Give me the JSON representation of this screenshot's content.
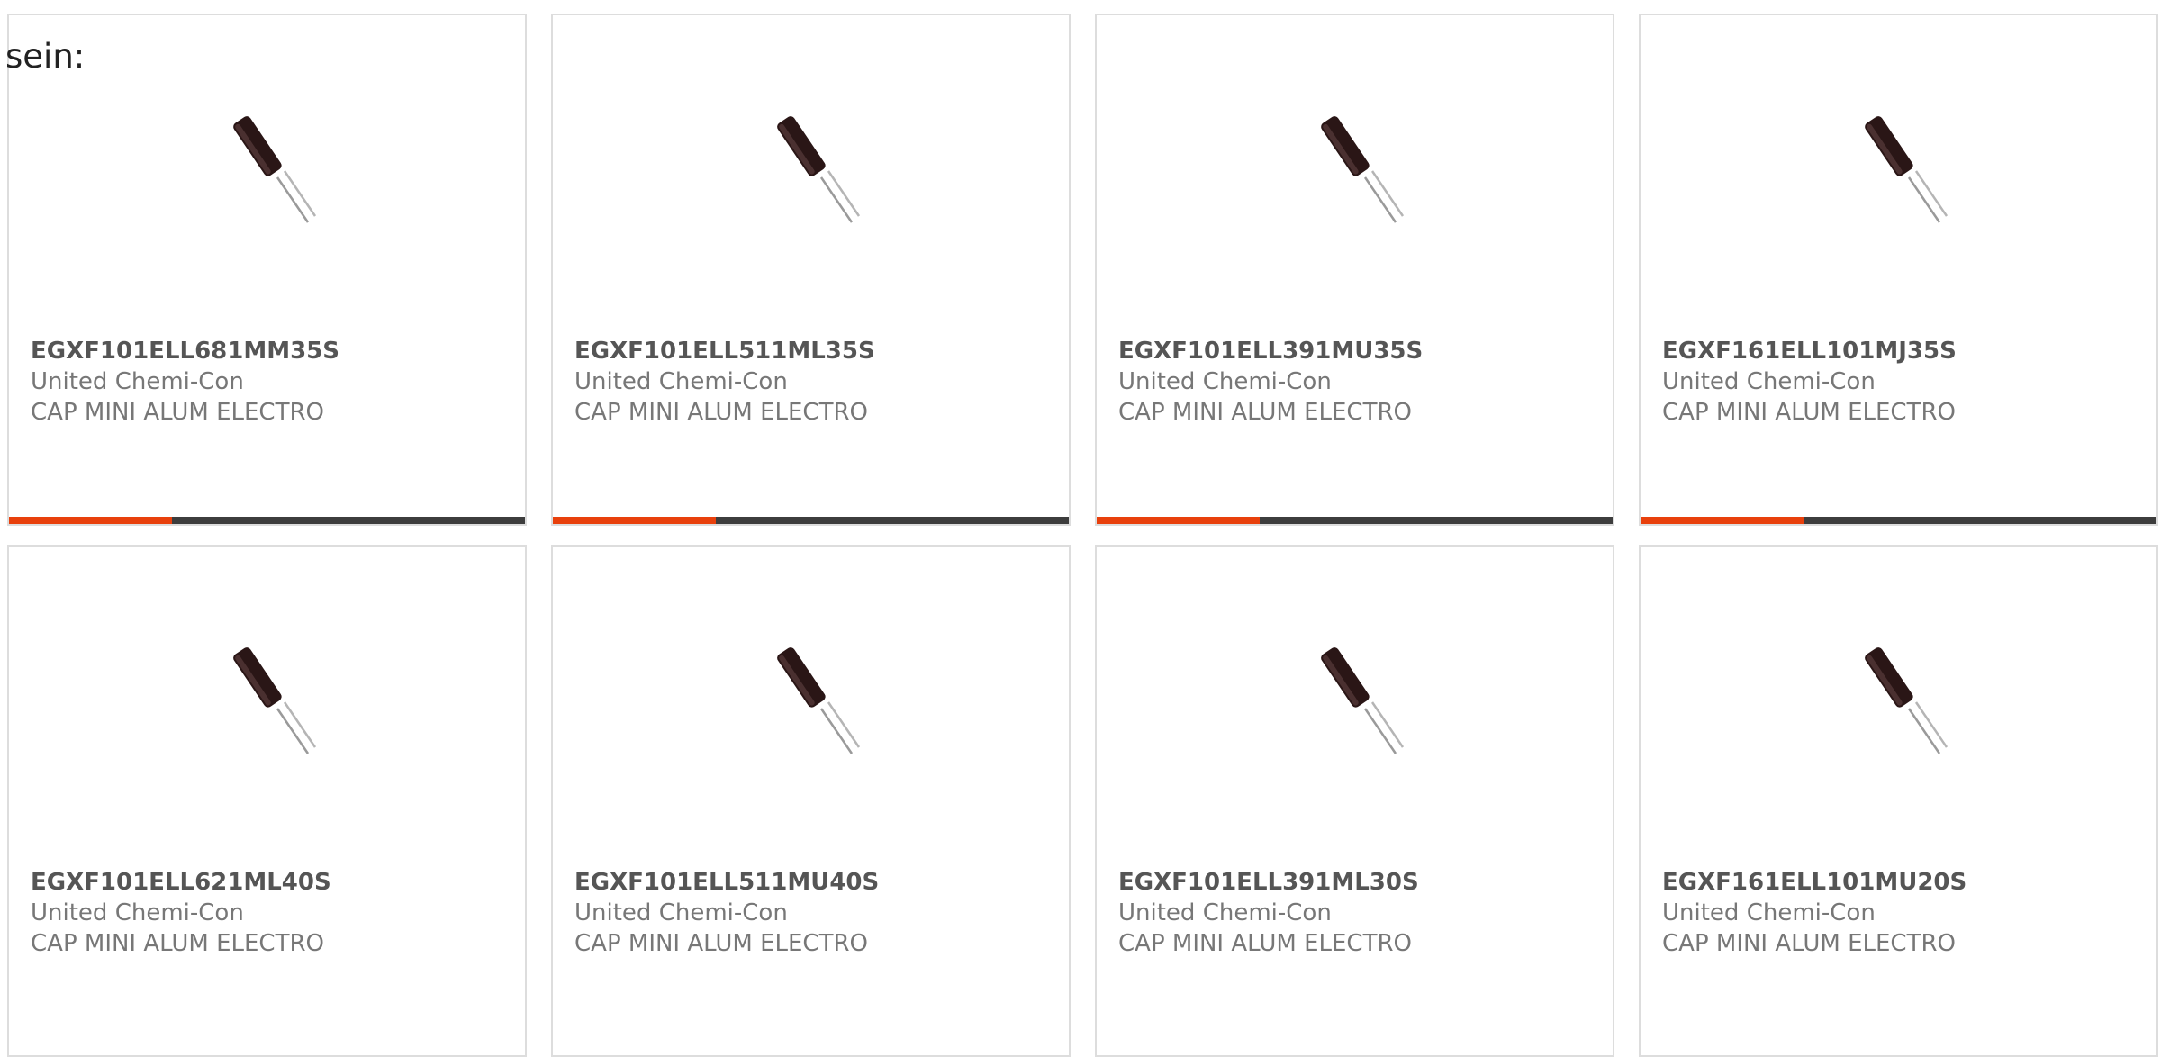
{
  "intro": {
    "text": "sein:"
  },
  "colors": {
    "accent": "#e8400c",
    "bar": "#3d3d3d",
    "border": "#dddddd",
    "title": "#555555",
    "text": "#777777"
  },
  "products": [
    {
      "part": "EGXF101ELL681MM35S",
      "brand": "United Chemi-Con",
      "description": "CAP MINI ALUM ELECTRO",
      "image": "capacitor-icon"
    },
    {
      "part": "EGXF101ELL511ML35S",
      "brand": "United Chemi-Con",
      "description": "CAP MINI ALUM ELECTRO",
      "image": "capacitor-icon"
    },
    {
      "part": "EGXF101ELL391MU35S",
      "brand": "United Chemi-Con",
      "description": "CAP MINI ALUM ELECTRO",
      "image": "capacitor-icon"
    },
    {
      "part": "EGXF161ELL101MJ35S",
      "brand": "United Chemi-Con",
      "description": "CAP MINI ALUM ELECTRO",
      "image": "capacitor-icon"
    },
    {
      "part": "EGXF101ELL621ML40S",
      "brand": "United Chemi-Con",
      "description": "CAP MINI ALUM ELECTRO",
      "image": "capacitor-icon"
    },
    {
      "part": "EGXF101ELL511MU40S",
      "brand": "United Chemi-Con",
      "description": "CAP MINI ALUM ELECTRO",
      "image": "capacitor-icon"
    },
    {
      "part": "EGXF101ELL391ML30S",
      "brand": "United Chemi-Con",
      "description": "CAP MINI ALUM ELECTRO",
      "image": "capacitor-icon"
    },
    {
      "part": "EGXF161ELL101MU20S",
      "brand": "United Chemi-Con",
      "description": "CAP MINI ALUM ELECTRO",
      "image": "capacitor-icon"
    }
  ]
}
